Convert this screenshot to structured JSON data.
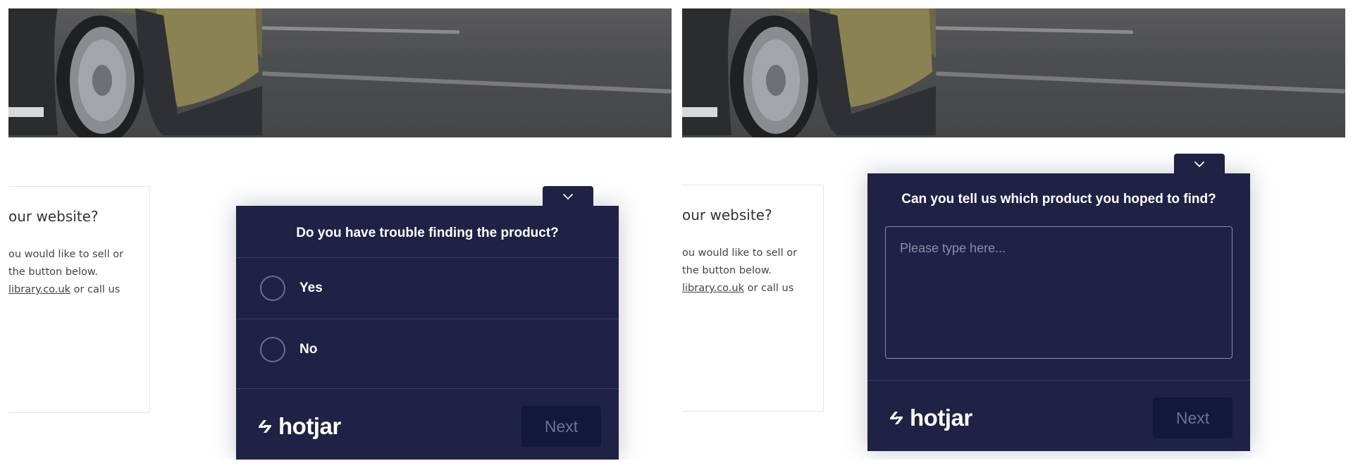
{
  "panels": [
    {
      "hero": {
        "image": "road-and-car-photo"
      },
      "info_card": {
        "title": " our website?",
        "line_a": "ou would like to sell or",
        "line_b": "the button below.",
        "line_c_link": "library.co.uk",
        "line_c_rest": " or call us"
      },
      "survey": {
        "collapse_icon": "chevron-down-icon",
        "question": "Do you have trouble finding the product?",
        "options": [
          {
            "label": "Yes"
          },
          {
            "label": "No"
          }
        ],
        "brand": "hotjar",
        "next_label": "Next"
      }
    },
    {
      "hero": {
        "image": "road-and-car-photo"
      },
      "info_card": {
        "title": " our website?",
        "line_a": "ou would like to sell or",
        "line_b": "the button below.",
        "line_c_link": "library.co.uk",
        "line_c_rest": " or call us"
      },
      "survey": {
        "collapse_icon": "chevron-down-icon",
        "question": "Can you tell us which product you hoped to find?",
        "textarea_placeholder": "Please type here...",
        "textarea_value": "",
        "brand": "hotjar",
        "next_label": "Next"
      }
    }
  ],
  "colors": {
    "survey_bg": "#1f2244",
    "next_button_bg": "#13173a",
    "next_button_text": "#6f7391",
    "divider": "#3a3e66"
  }
}
